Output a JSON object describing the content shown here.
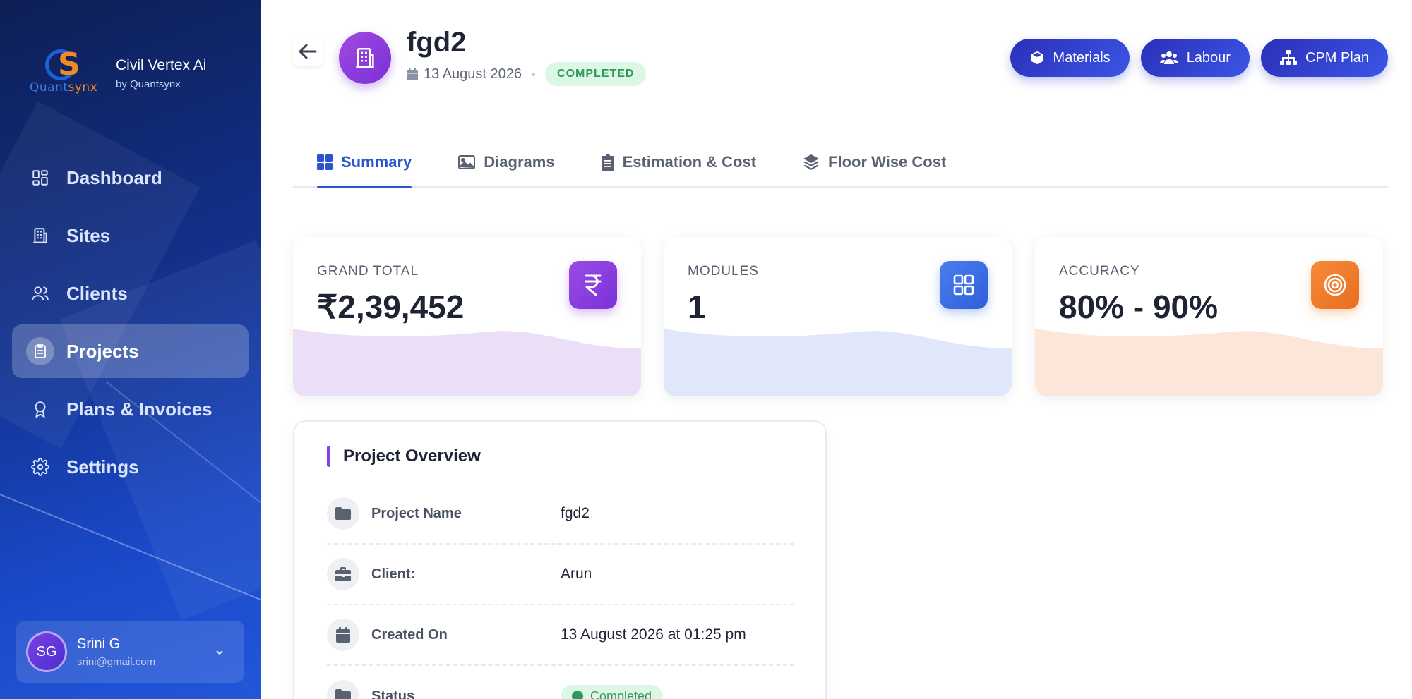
{
  "app": {
    "brand_name": "Civil Vertex Ai",
    "brand_by": "by Quantsynx",
    "logo_letters": "CS",
    "logo_word_a": "Quant",
    "logo_word_b": "synx"
  },
  "sidebar": {
    "items": [
      {
        "label": "Dashboard",
        "icon": "dashboard-icon"
      },
      {
        "label": "Sites",
        "icon": "building-icon"
      },
      {
        "label": "Clients",
        "icon": "users-icon"
      },
      {
        "label": "Projects",
        "icon": "clipboard-icon",
        "active": true
      },
      {
        "label": "Plans & Invoices",
        "icon": "award-icon"
      },
      {
        "label": "Settings",
        "icon": "gear-icon"
      }
    ],
    "user": {
      "initials": "SG",
      "name": "Srini G",
      "email": "srini@gmail.com"
    }
  },
  "header": {
    "title": "fgd2",
    "date": "13 August 2026",
    "status": "COMPLETED",
    "actions": [
      "Materials",
      "Labour",
      "CPM Plan"
    ]
  },
  "tabs": [
    {
      "label": "Summary",
      "icon": "grid-icon",
      "active": true
    },
    {
      "label": "Diagrams",
      "icon": "image-icon"
    },
    {
      "label": "Estimation & Cost",
      "icon": "clipboard-list-icon"
    },
    {
      "label": "Floor Wise Cost",
      "icon": "layers-icon"
    }
  ],
  "stats": [
    {
      "label": "GRAND TOTAL",
      "value": "₹2,39,452",
      "icon": "rupee-icon",
      "color": "#8b3fe0",
      "wave": "#ebdff7"
    },
    {
      "label": "MODULES",
      "value": "1",
      "icon": "grid-icon",
      "color": "#3b6fe8",
      "wave": "#e0e7fa"
    },
    {
      "label": "ACCURACY",
      "value": "80% - 90%",
      "icon": "target-icon",
      "color": "#f07d2c",
      "wave": "#fbe6d9"
    }
  ],
  "overview": {
    "title": "Project Overview",
    "rows": [
      {
        "key": "Project Name",
        "value": "fgd2",
        "icon": "folder-icon"
      },
      {
        "key": "Client:",
        "value": "Arun",
        "icon": "briefcase-icon"
      },
      {
        "key": "Created On",
        "value": "13 August 2026 at 01:25 pm",
        "icon": "calendar-icon"
      },
      {
        "key": "Status",
        "value": "Completed",
        "icon": "flag-icon"
      }
    ]
  }
}
